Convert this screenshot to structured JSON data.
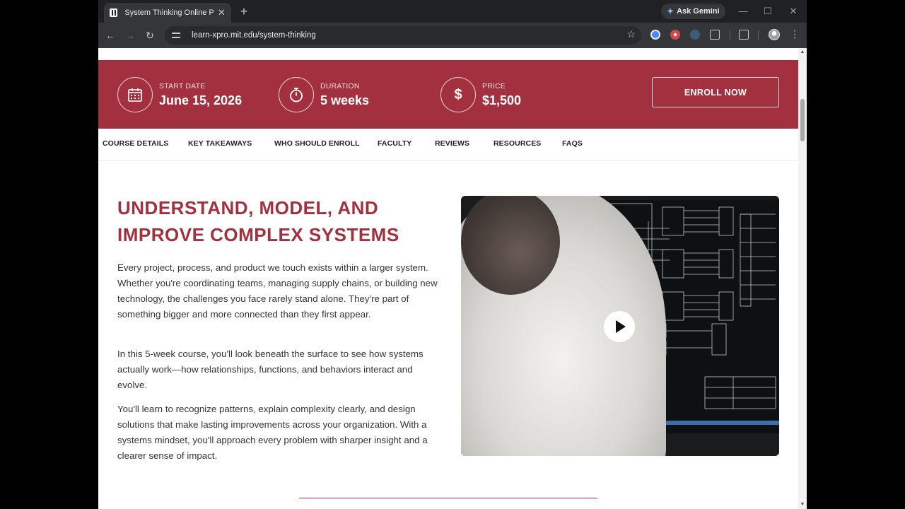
{
  "browser": {
    "tab_title": "System Thinking Online Profess",
    "new_tab": "+",
    "tab_close": "✕",
    "gemini_label": "Ask Gemini",
    "url": "learn-xpro.mit.edu/system-thinking"
  },
  "info_bar": {
    "start_label": "START DATE",
    "start_value": "June 15, 2026",
    "duration_label": "DURATION",
    "duration_value": "5 weeks",
    "price_label": "PRICE",
    "price_value": "$1,500",
    "enroll_label": "ENROLL NOW"
  },
  "subnav": [
    "COURSE DETAILS",
    "KEY TAKEAWAYS",
    "WHO SHOULD ENROLL",
    "FACULTY",
    "REVIEWS",
    "RESOURCES",
    "FAQS"
  ],
  "main": {
    "headline": "UNDERSTAND, MODEL, AND IMPROVE COMPLEX SYSTEMS",
    "para1": "Every project, process, and product we touch exists within a larger system. Whether you're coordinating teams, managing supply chains, or building new technology, the challenges you face rarely stand alone. They're part of something bigger and more connected than they first appear.",
    "para2": "In this 5-week course, you'll look beneath the surface to see how systems actually work—how relationships, functions, and behaviors interact and evolve.",
    "para3": "You'll learn to recognize patterns, explain complexity clearly, and design solutions that make lasting improvements across your organization. With a systems mindset, you'll approach every problem with sharper insight and a clearer sense of impact."
  },
  "colors": {
    "brand": "#a3303e",
    "browser_dark": "#202124",
    "toolbar": "#35363a"
  }
}
